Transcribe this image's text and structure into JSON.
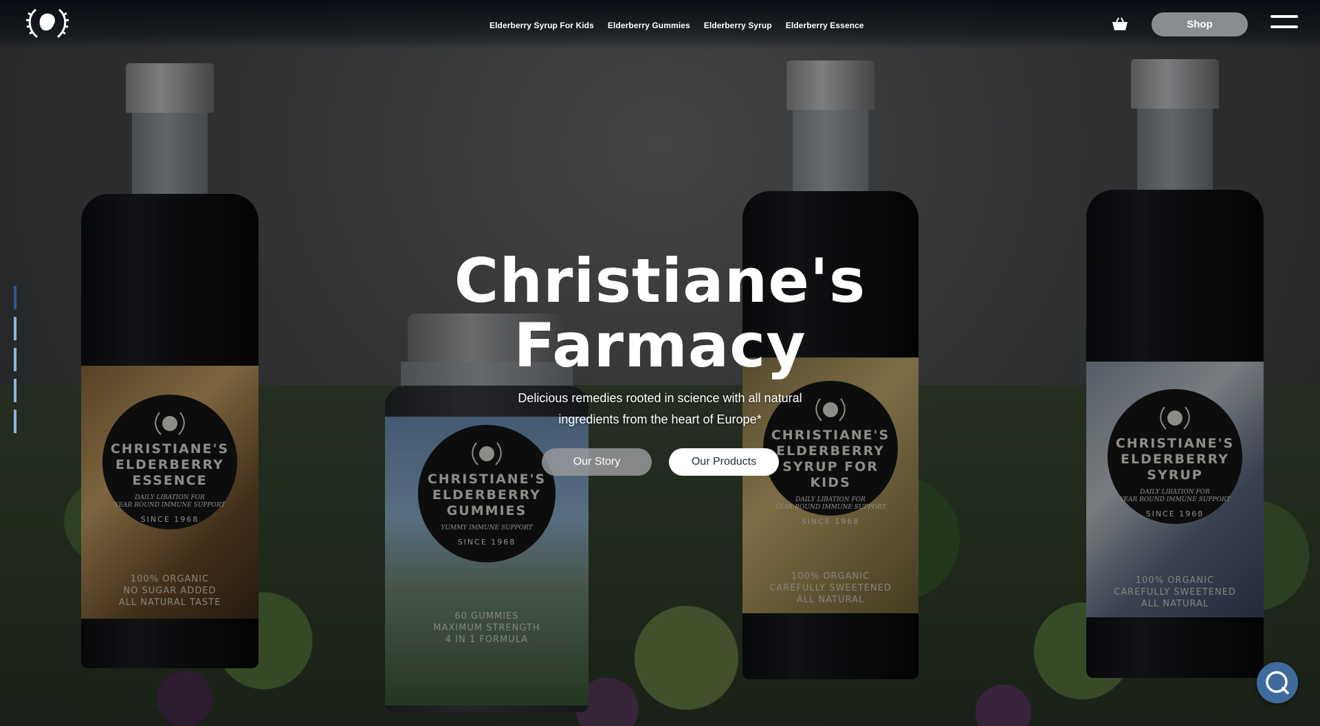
{
  "brand": {
    "logo_icon": "farmacy-laurel-logo-icon"
  },
  "nav": {
    "items": [
      {
        "label": "Elderberry Syrup For Kids"
      },
      {
        "label": "Elderberry Gummies"
      },
      {
        "label": "Elderberry Syrup"
      },
      {
        "label": "Elderberry Essence"
      }
    ]
  },
  "header": {
    "cart_icon": "basket-icon",
    "shop_label": "Shop",
    "menu_icon": "hamburger-menu-icon"
  },
  "slides": {
    "count": 5,
    "active_index": 0
  },
  "hero": {
    "title_line1": "Christiane's",
    "title_line2": "Farmacy",
    "subtitle_line1": "Delicious remedies rooted in science with all natural",
    "subtitle_line2": "ingredients from the heart of Europe*",
    "story_label": "Our Story",
    "products_label": "Our Products"
  },
  "products": [
    {
      "title": "CHRISTIANE'S\nELDERBERRY\nESSENCE",
      "tagline": "DAILY LIBATION FOR\nYEAR ROUND IMMUNE SUPPORT",
      "since": "SINCE 1968",
      "footer": "100% ORGANIC\nNO SUGAR ADDED\nALL NATURAL TASTE"
    },
    {
      "title": "CHRISTIANE'S\nELDERBERRY\nGUMMIES",
      "tagline": "YUMMY IMMUNE SUPPORT",
      "since": "SINCE 1968",
      "footer": "60 GUMMIES\nMAXIMUM STRENGTH\n4 IN 1 FORMULA"
    },
    {
      "title": "CHRISTIANE'S\nELDERBERRY\nSYRUP FOR KIDS",
      "tagline": "DAILY LIBATION FOR\nYEAR ROUND IMMUNE SUPPORT",
      "since": "SINCE 1968",
      "footer": "100% ORGANIC\nCAREFULLY SWEETENED\nALL NATURAL"
    },
    {
      "title": "CHRISTIANE'S\nELDERBERRY\nSYRUP",
      "tagline": "DAILY LIBATION FOR\nYEAR ROUND IMMUNE SUPPORT",
      "since": "SINCE 1968",
      "footer": "100% ORGANIC\nCAREFULLY SWEETENED\nALL NATURAL"
    }
  ],
  "chat": {
    "icon": "chat-bubble-icon"
  },
  "colors": {
    "accent_blue": "#3e6b9c",
    "slide_active": "#2a5a8e",
    "slide_inactive": "#8fb3dc",
    "shop_button": "#8a8d90"
  }
}
